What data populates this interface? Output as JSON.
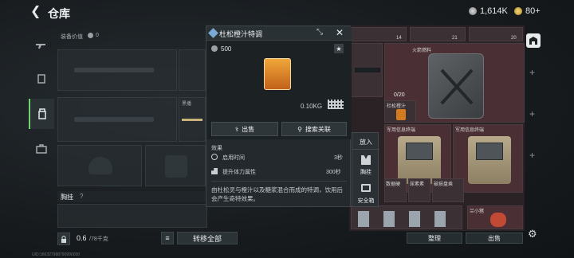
{
  "header": {
    "title": "仓库",
    "currency1": "1,614K",
    "currency2": "80+"
  },
  "left": {
    "equip_value_label": "装备价值",
    "equip_value": "0",
    "slot_ammo_label": "黑播",
    "vest_label": "胸挂",
    "vest_help": "?",
    "capacity": "0.6",
    "capacity_max": "/78千克",
    "transfer_all": "转移全部"
  },
  "popup": {
    "title": "杜松橙汁特调",
    "value": "500",
    "weight": "0.10KG",
    "sell": "出售",
    "search": "搜索关联",
    "effects_label": "效果",
    "effect1_name": "启用时间",
    "effect1_value": "3秒",
    "effect2_name": "提升体力属性",
    "effect2_value": "300秒",
    "description": "由杜松灵与橙汁以及糖浆混合而成的特调，饮用后会产生奇特效果。"
  },
  "context_menu": {
    "put_in": "放入",
    "vest": "胸挂",
    "safe_box": "安全箱"
  },
  "right": {
    "badge1": "14",
    "badge2": "21",
    "badge3": "20",
    "fuel_label": "火箭燃料",
    "ammo_count": "0/20",
    "orange_label": "杜松橙汁",
    "case_label1": "军用信息终端",
    "case_label2": "军用信息终端",
    "data_label1": "数据硬",
    "data_label2": "尿素素",
    "data_label3": "破损盘乘",
    "small_label": "兰小猪",
    "sort": "整理",
    "sell": "出售"
  },
  "status_bar": "UID:160327988790990030"
}
